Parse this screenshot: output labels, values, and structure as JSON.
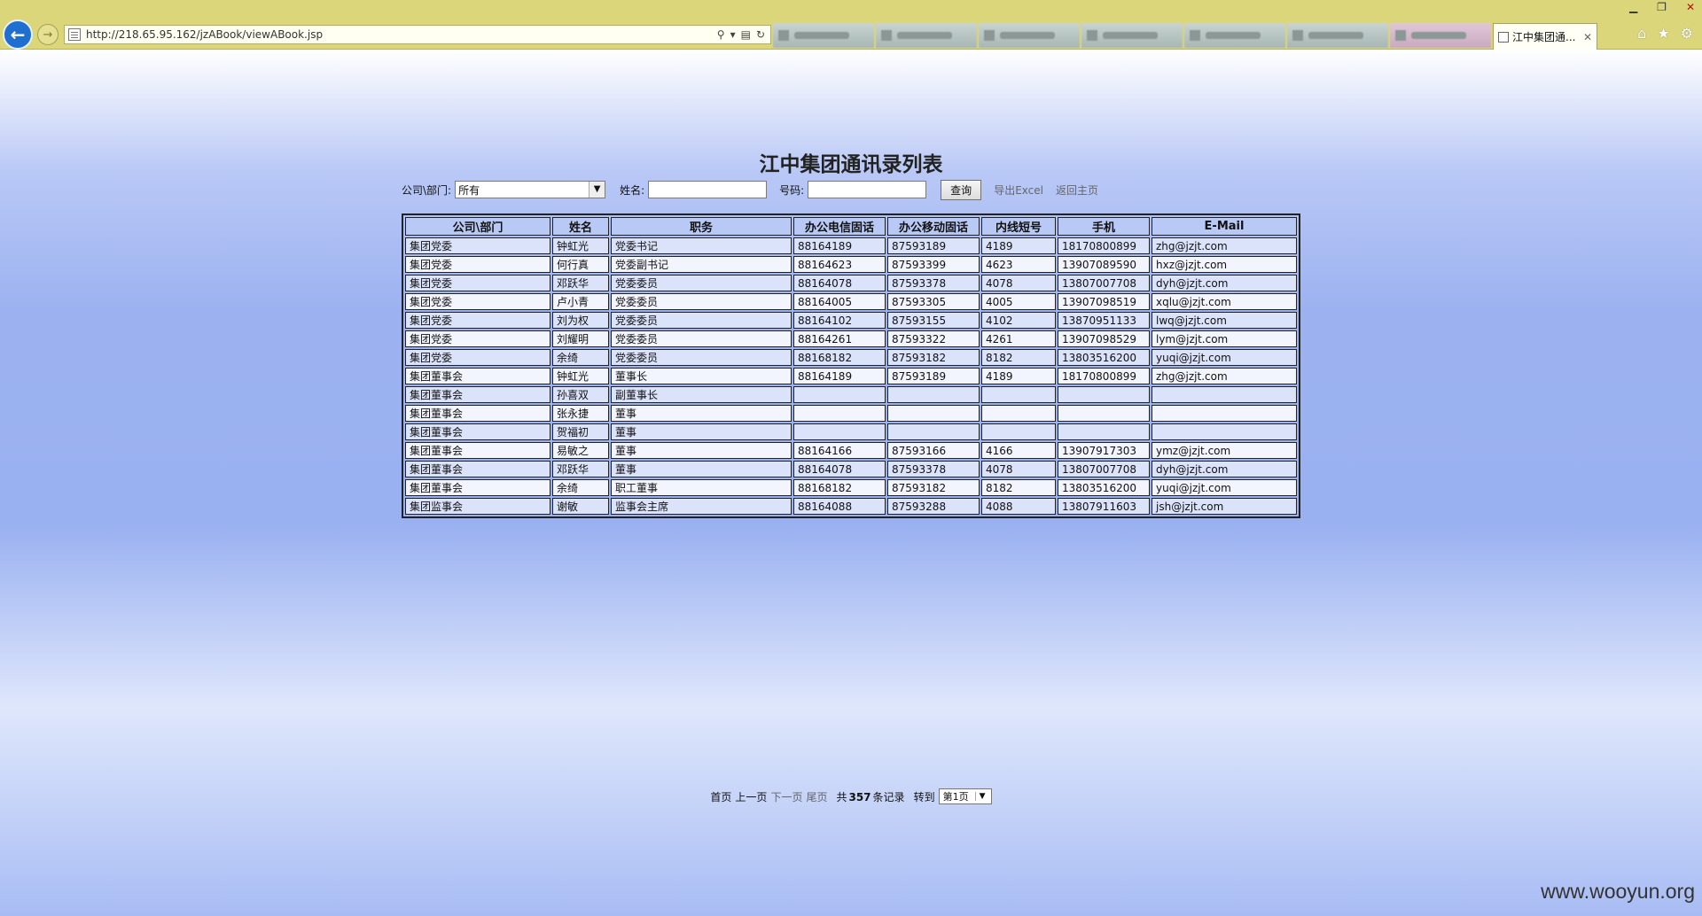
{
  "browser": {
    "url": "http://218.65.95.162/jzABook/viewABook.jsp",
    "active_tab_title": "江中集团通..."
  },
  "page": {
    "title": "江中集团通讯录列表",
    "filters": {
      "dept_label": "公司\\部门:",
      "dept_value": "所有",
      "name_label": "姓名:",
      "number_label": "号码:",
      "query_button": "查询",
      "export_link": "导出Excel",
      "home_link": "返回主页"
    },
    "table": {
      "headers": [
        "公司\\部门",
        "姓名",
        "职务",
        "办公电信固话",
        "办公移动固话",
        "内线短号",
        "手机",
        "E-Mail"
      ],
      "rows": [
        [
          "集团党委",
          "钟虹光",
          "党委书记",
          "88164189",
          "87593189",
          "4189",
          "18170800899",
          "zhg@jzjt.com"
        ],
        [
          "集团党委",
          "何行真",
          "党委副书记",
          "88164623",
          "87593399",
          "4623",
          "13907089590",
          "hxz@jzjt.com"
        ],
        [
          "集团党委",
          "邓跃华",
          "党委委员",
          "88164078",
          "87593378",
          "4078",
          "13807007708",
          "dyh@jzjt.com"
        ],
        [
          "集团党委",
          "卢小青",
          "党委委员",
          "88164005",
          "87593305",
          "4005",
          "13907098519",
          "xqlu@jzjt.com"
        ],
        [
          "集团党委",
          "刘为权",
          "党委委员",
          "88164102",
          "87593155",
          "4102",
          "13870951133",
          "lwq@jzjt.com"
        ],
        [
          "集团党委",
          "刘耀明",
          "党委委员",
          "88164261",
          "87593322",
          "4261",
          "13907098529",
          "lym@jzjt.com"
        ],
        [
          "集团党委",
          "余绮",
          "党委委员",
          "88168182",
          "87593182",
          "8182",
          "13803516200",
          "yuqi@jzjt.com"
        ],
        [
          "集团董事会",
          "钟虹光",
          "董事长",
          "88164189",
          "87593189",
          "4189",
          "18170800899",
          "zhg@jzjt.com"
        ],
        [
          "集团董事会",
          "孙喜双",
          "副董事长",
          "",
          "",
          "",
          "",
          ""
        ],
        [
          "集团董事会",
          "张永捷",
          "董事",
          "",
          "",
          "",
          "",
          ""
        ],
        [
          "集团董事会",
          "贺福初",
          "董事",
          "",
          "",
          "",
          "",
          ""
        ],
        [
          "集团董事会",
          "易敏之",
          "董事",
          "88164166",
          "87593166",
          "4166",
          "13907917303",
          "ymz@jzjt.com"
        ],
        [
          "集团董事会",
          "邓跃华",
          "董事",
          "88164078",
          "87593378",
          "4078",
          "13807007708",
          "dyh@jzjt.com"
        ],
        [
          "集团董事会",
          "余绮",
          "职工董事",
          "88168182",
          "87593182",
          "8182",
          "13803516200",
          "yuqi@jzjt.com"
        ],
        [
          "集团监事会",
          "谢敏",
          "监事会主席",
          "88164088",
          "87593288",
          "4088",
          "13807911603",
          "jsh@jzjt.com"
        ]
      ]
    },
    "pager": {
      "first": "首页",
      "prev": "上一页",
      "next": "下一页",
      "last": "尾页",
      "total_prefix": "共",
      "total_count": "357",
      "total_suffix": "条记录",
      "goto_label": "转到",
      "goto_value": "第1页"
    },
    "watermark": "www.wooyun.org"
  }
}
